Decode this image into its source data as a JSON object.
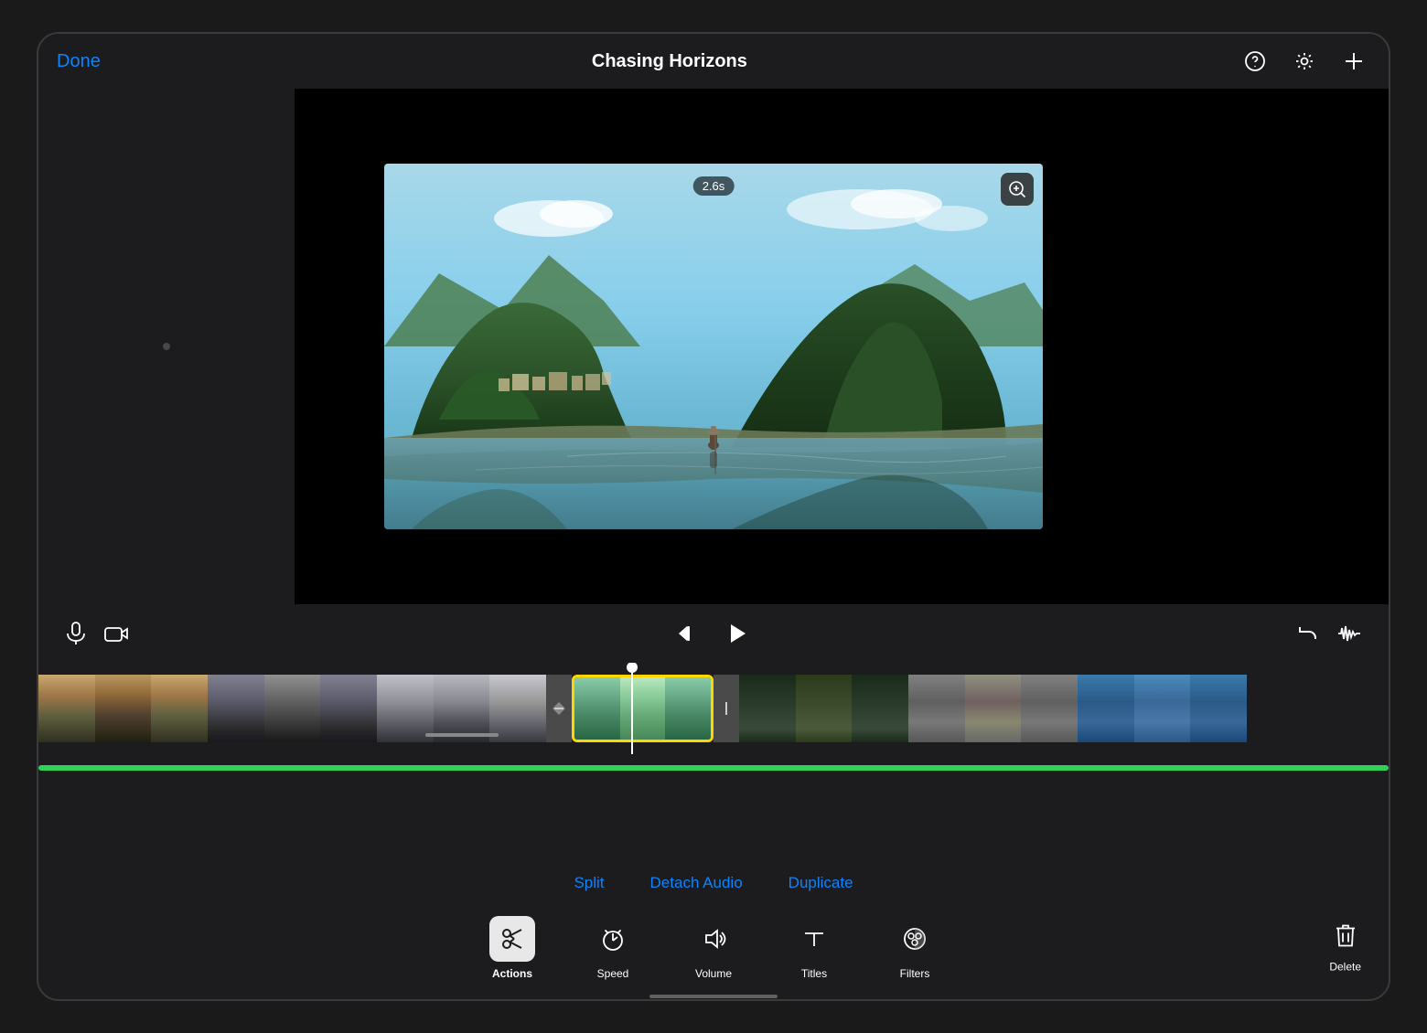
{
  "app": {
    "title": "Chasing Horizons"
  },
  "header": {
    "done_label": "Done",
    "title": "Chasing Horizons"
  },
  "video": {
    "time_indicator": "2.6s"
  },
  "controls": {
    "rewind_icon": "⏮",
    "play_icon": "▶",
    "undo_icon": "↩",
    "waveform_icon": "≋"
  },
  "action_menu": {
    "split_label": "Split",
    "detach_audio_label": "Detach Audio",
    "duplicate_label": "Duplicate"
  },
  "toolbar": {
    "items": [
      {
        "id": "actions",
        "label": "Actions",
        "active": true
      },
      {
        "id": "speed",
        "label": "Speed"
      },
      {
        "id": "volume",
        "label": "Volume"
      },
      {
        "id": "titles",
        "label": "Titles"
      },
      {
        "id": "filters",
        "label": "Filters"
      }
    ],
    "delete_label": "Delete"
  }
}
